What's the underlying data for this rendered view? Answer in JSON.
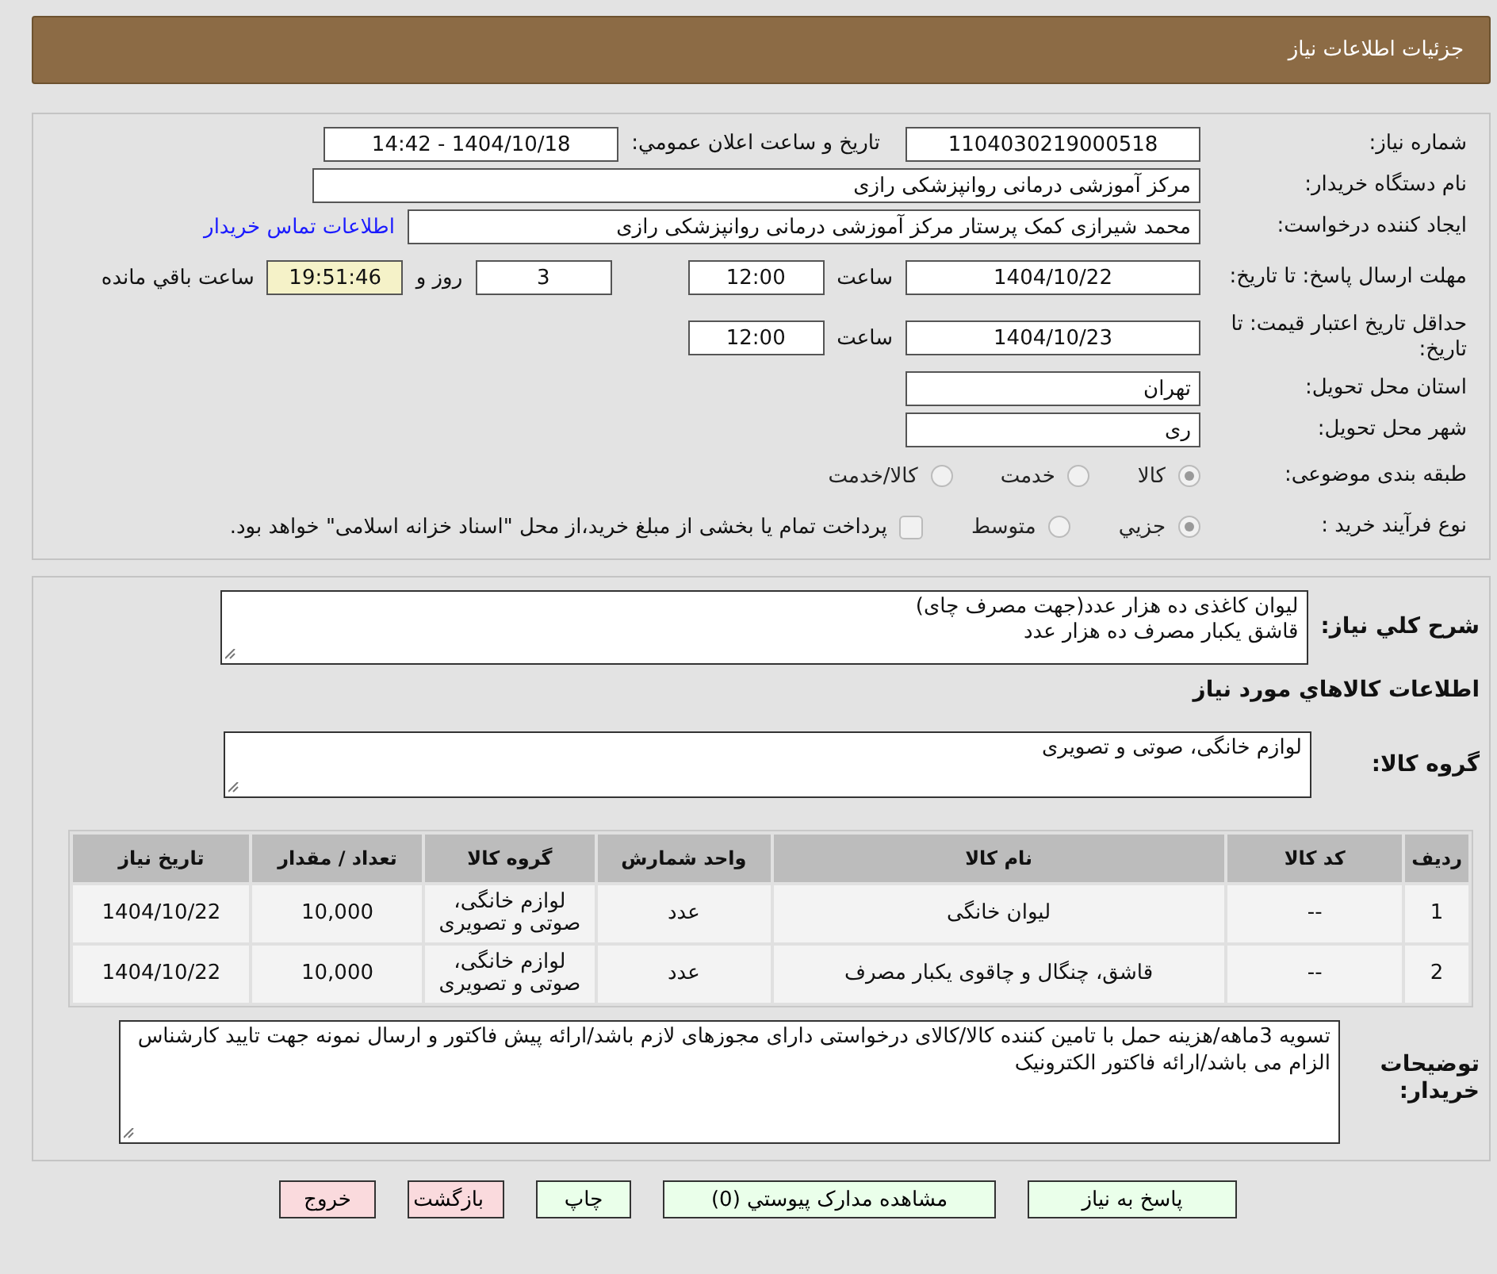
{
  "header": {
    "title": "جزئیات اطلاعات نیاز"
  },
  "need_number": {
    "label": "شماره نیاز:",
    "value": "1104030219000518"
  },
  "announce": {
    "label": "تاریخ و ساعت اعلان عمومي:",
    "value": "1404/10/18 - 14:42"
  },
  "buyer_org": {
    "label": "نام دستگاه خريدار:",
    "value": "مرکز آموزشی درمانی روانپزشکی رازی"
  },
  "requester": {
    "label": "ايجاد کننده درخواست:",
    "value": "محمد شیرازی کمک پرستار مرکز آموزشی درمانی روانپزشکی رازی",
    "link": "اطلاعات تماس خريدار"
  },
  "reply_deadline": {
    "label": "مهلت ارسال پاسخ: تا تاريخ:",
    "date": "1404/10/22",
    "time_label": "ساعت",
    "time": "12:00",
    "days": "3",
    "days_label": "روز و",
    "remaining": "19:51:46",
    "remaining_label": "ساعت باقي مانده"
  },
  "price_validity": {
    "label": "حداقل تاريخ اعتبار قيمت: تا تاريخ:",
    "date": "1404/10/23",
    "time_label": "ساعت",
    "time": "12:00"
  },
  "province": {
    "label": "استان محل تحويل:",
    "value": "تهران"
  },
  "city": {
    "label": "شهر محل تحويل:",
    "value": "ری"
  },
  "category": {
    "label": "طبقه بندی موضوعی:",
    "options": [
      {
        "label": "کالا",
        "selected": true
      },
      {
        "label": "خدمت",
        "selected": false
      },
      {
        "label": "کالا/خدمت",
        "selected": false
      }
    ]
  },
  "purchase_type": {
    "label": "نوع فرآیند خرید :",
    "options": [
      {
        "label": "جزيي",
        "selected": true
      },
      {
        "label": "متوسط",
        "selected": false
      }
    ],
    "payment": {
      "checked": false,
      "text": "پرداخت تمام يا بخشی از مبلغ خريد،از محل \"اسناد خزانه اسلامی\" خواهد بود."
    }
  },
  "description": {
    "label": "شرح کلي نياز:",
    "lines": [
      "لیوان کاغذی ده هزار عدد(جهت مصرف چای)",
      "قاشق یکبار مصرف ده هزار عدد"
    ]
  },
  "goods_title": "اطلاعات کالاهاي مورد نياز",
  "goods_group": {
    "label": "گروه کالا:",
    "value": "لوازم خانگی، صوتی و تصویری"
  },
  "table": {
    "columns": [
      "رديف",
      "کد کالا",
      "نام کالا",
      "واحد شمارش",
      "گروه کالا",
      "تعداد / مقدار",
      "تاريخ نياز"
    ],
    "rows": [
      [
        "1",
        "--",
        "لیوان خانگی",
        "عدد",
        "لوازم خانگی، صوتی و تصویری",
        "10,000",
        "1404/10/22"
      ],
      [
        "2",
        "--",
        "قاشق، چنگال و چاقوی یکبار مصرف",
        "عدد",
        "لوازم خانگی، صوتی و تصویری",
        "10,000",
        "1404/10/22"
      ]
    ]
  },
  "notes": {
    "label": "توضيحات خريدار:",
    "value": "تسویه 3ماهه/هزینه حمل با تامین کننده کالا/کالای درخواستی دارای مجوزهای لازم باشد/ارائه پیش فاکتور و ارسال نمونه جهت تایید کارشناس الزام می باشد/ارائه فاکتور الکترونیک"
  },
  "buttons": [
    {
      "label": "پاسخ به نياز",
      "kind": "action"
    },
    {
      "label": "مشاهده مدارک پيوستي (0)",
      "kind": "action"
    },
    {
      "label": "چاپ",
      "kind": "action"
    },
    {
      "label": "بازگشت",
      "kind": "exit"
    },
    {
      "label": "خروج",
      "kind": "exit"
    }
  ]
}
